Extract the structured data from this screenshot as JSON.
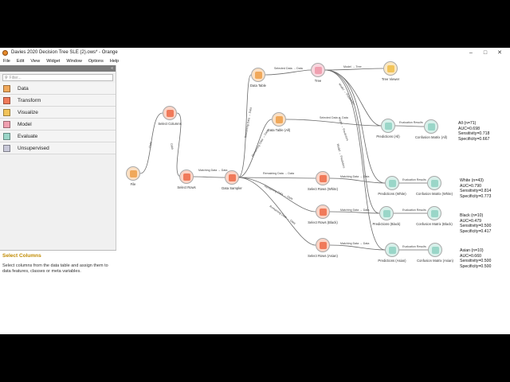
{
  "window": {
    "title": "Davies 2020 Decision Tree SLE (2).ows* - Orange"
  },
  "menu": [
    "File",
    "Edit",
    "View",
    "Widget",
    "Window",
    "Options",
    "Help"
  ],
  "panel": {
    "filter_placeholder": "Filter...",
    "categories": [
      {
        "label": "Data",
        "color": "#f0a85a"
      },
      {
        "label": "Transform",
        "color": "#f07a5a"
      },
      {
        "label": "Visualize",
        "color": "#f2c45a"
      },
      {
        "label": "Model",
        "color": "#f0a0b0"
      },
      {
        "label": "Evaluate",
        "color": "#9ad6c8"
      },
      {
        "label": "Unsupervised",
        "color": "#c8c8d8"
      }
    ],
    "info_title": "Select Columns",
    "info_desc": "Select columns from the data table and assign them to data features, classes or meta variables."
  },
  "colors": {
    "data": "#f0a85a",
    "transform": "#f07a5a",
    "visualize": "#f2c45a",
    "model": "#f0a0b0",
    "evaluate": "#9ad6c8"
  },
  "nodes": {
    "file": "File",
    "select_columns": "Select Columns",
    "select_rows": "Select Rows",
    "data_sampler": "Data Sampler",
    "data_table": "Data Table",
    "data_table_all": "Data Table (All)",
    "tree": "Tree",
    "tree_viewer": "Tree Viewer",
    "predictions_all": "Predictions (All)",
    "confusion_all": "Confusion Matrix (All)",
    "select_rows_white": "Select Rows (White)",
    "predictions_white": "Predictions (White)",
    "confusion_white": "Confusion Matrix (White)",
    "select_rows_black": "Select Rows (Black)",
    "predictions_black": "Predictions (Black)",
    "confusion_black": "Confusion Matrix (Black)",
    "select_rows_asian": "Select Rows (Asian)",
    "predictions_asian": "Predictions (Asian)",
    "confusion_asian": "Confusion Matrix (Asian)"
  },
  "edges": {
    "data": "Data",
    "matching_data": "Matching Data → Data",
    "remaining_data": "Remaining Data → Data",
    "selected_data": "Selected Data → Data",
    "model_tree": "Model → Tree",
    "model_predictors": "Model → Predictors",
    "evaluation_results": "Evaluation Results"
  },
  "results": {
    "all": [
      "All (n=71)",
      "AUC=0.698",
      "Sensitivity=0.718",
      "Specificity=0.667"
    ],
    "white": [
      "White (n=43)",
      "AUC=0.790",
      "Sensitivity=0.814",
      "Specificity=0.773"
    ],
    "black": [
      "Black (n=10)",
      "AUC=0.479",
      "Sensitivity=0.500",
      "Specificity=0.417"
    ],
    "asian": [
      "Asian (n=10)",
      "AUC=0.660",
      "Sensitivity=0.500",
      "Specificity=0.500"
    ]
  }
}
